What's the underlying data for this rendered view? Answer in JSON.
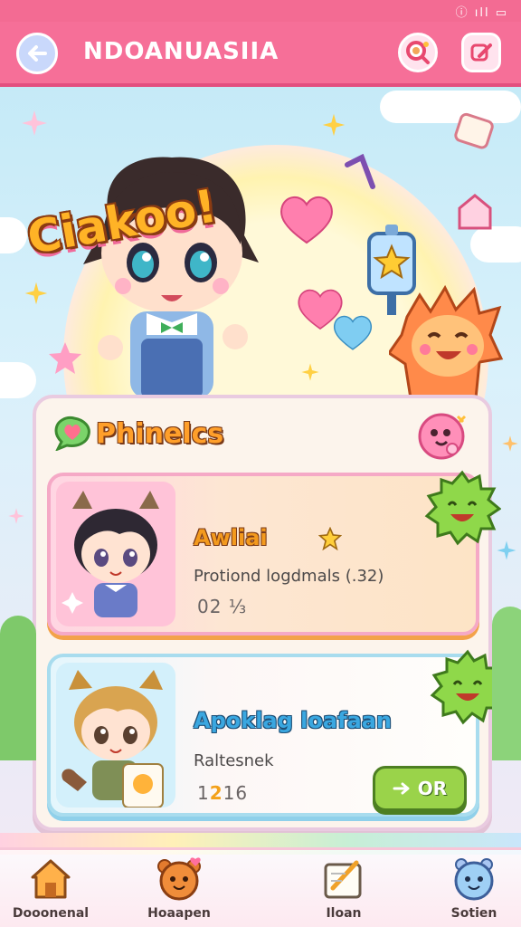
{
  "header": {
    "title": "NDOANUASIIA",
    "back_icon": "arrow-left-icon",
    "search_icon": "search-icon",
    "edit_icon": "pencil-icon"
  },
  "status_bar": {
    "indicators": "ⓘ ıll ▭"
  },
  "hero": {
    "title": "Ciakoo!"
  },
  "panel": {
    "title": "Phinelcs",
    "cards": [
      {
        "name": "Awliai",
        "subtitle": "Protiond logdmals (.32)",
        "count": "02 ⅓"
      },
      {
        "name": "Apoklag loafaan",
        "subtitle": "Raltesnek",
        "count_prefix": "1",
        "count_highlight": "2",
        "count_suffix": "16",
        "button_label": "OR",
        "button_icon": "arrow-right-icon"
      }
    ]
  },
  "nav": {
    "items": [
      {
        "label": "Dooonenal",
        "icon": "house-icon"
      },
      {
        "label": "Hoaapen",
        "icon": "bear-icon"
      },
      {
        "label": "Iloan",
        "icon": "notepad-icon"
      },
      {
        "label": "Sotien",
        "icon": "cat-face-icon"
      }
    ]
  },
  "colors": {
    "header": "#f66f98",
    "accent_orange": "#ff9f2a",
    "accent_blue": "#3aa7e0",
    "button_green": "#9ad34a"
  }
}
